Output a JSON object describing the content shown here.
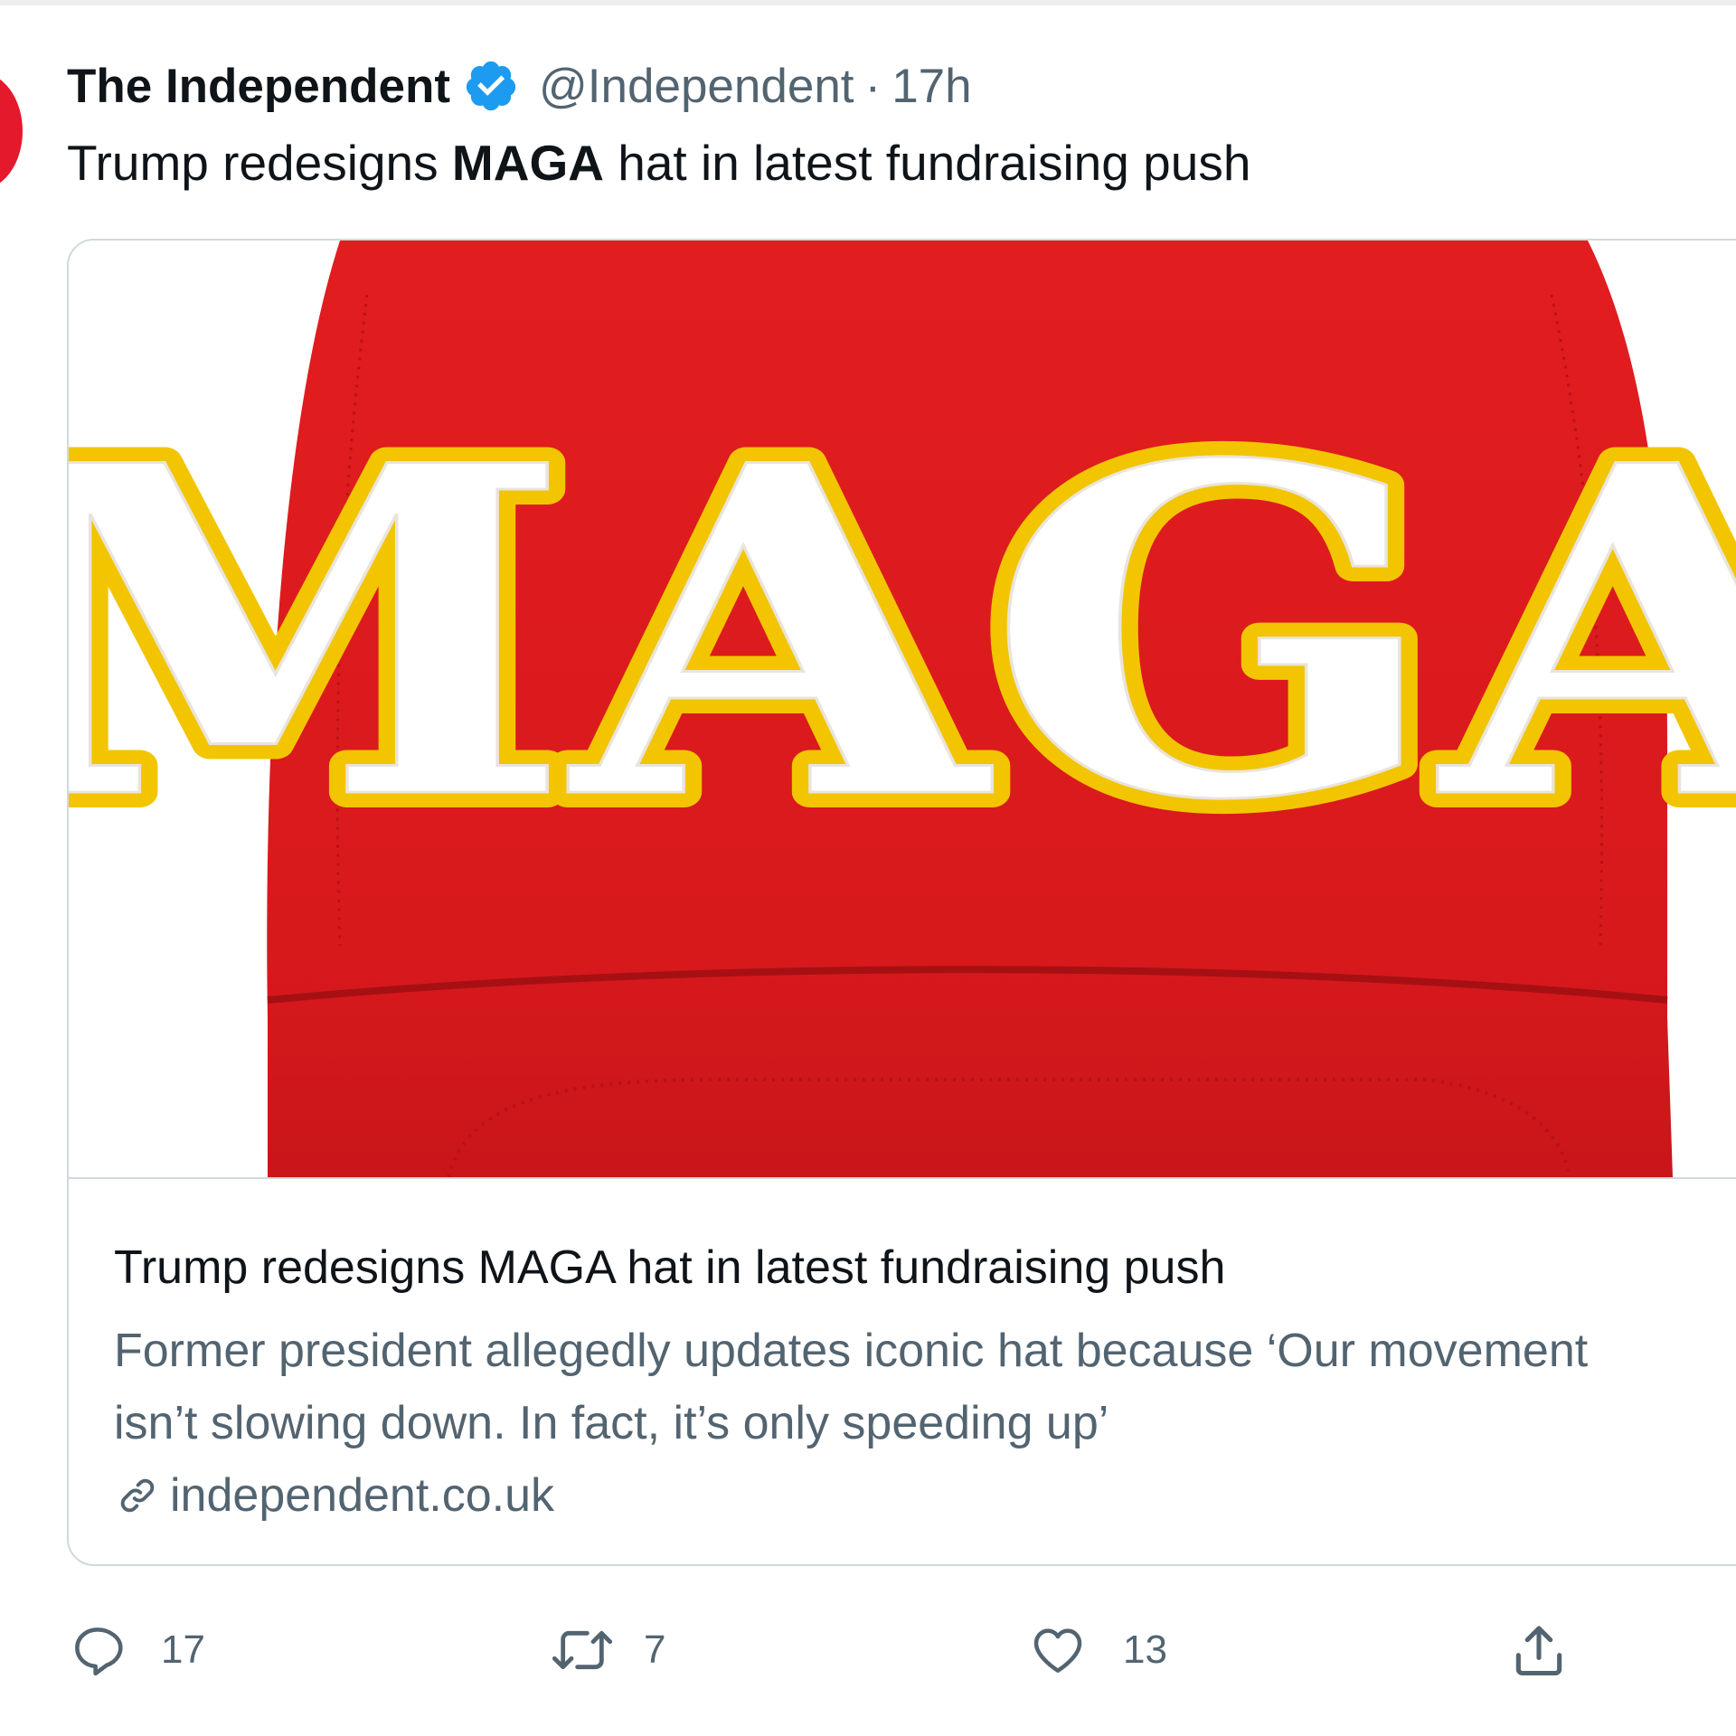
{
  "tweet": {
    "author_name": "The Independent",
    "handle": "@Independent",
    "separator": "·",
    "time": "17h",
    "verified_icon": "verified-badge-icon",
    "text_before": "Trump redesigns ",
    "text_bold": "MAGA",
    "text_after": " hat in latest fundraising push",
    "avatar_color": "#e4192c"
  },
  "card": {
    "image": {
      "hat_text": "MAGA",
      "hat_color": "#d8191c",
      "outline_color": "#f2c500",
      "letter_color": "#ffffff"
    },
    "title": "Trump redesigns MAGA hat in latest fundraising push",
    "description_line1": "Former president allegedly updates iconic hat because ‘Our movement",
    "description_line2": "isn’t slowing down. In fact, it’s only speeding up’",
    "domain": "independent.co.uk",
    "link_icon": "link-icon"
  },
  "actions": {
    "reply": {
      "icon": "reply-icon",
      "count": "17"
    },
    "retweet": {
      "icon": "retweet-icon",
      "count": "7"
    },
    "like": {
      "icon": "heart-icon",
      "count": "13"
    },
    "share": {
      "icon": "share-icon"
    }
  },
  "colors": {
    "text_primary": "#0f1419",
    "text_secondary": "#536471",
    "border": "#cfd9de",
    "verified_blue": "#1d9bf0"
  }
}
